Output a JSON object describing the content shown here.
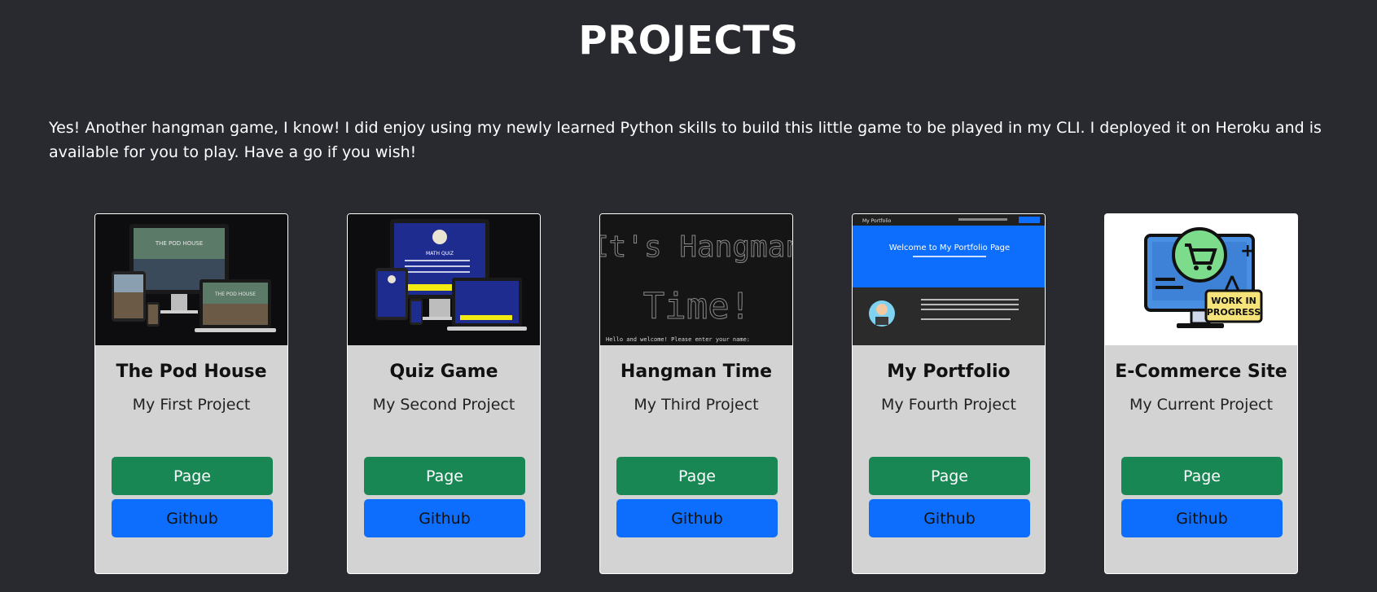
{
  "header": {
    "title": "PROJECTS"
  },
  "intro": {
    "text": "Yes! Another hangman game, I know! I did enjoy using my newly learned Python skills to build this little game to be played in my CLI. I deployed it on Heroku and is available for you to play. Have a go if you wish!"
  },
  "colors": {
    "background": "#282a30",
    "card": "#d3d3d3",
    "page_button": "#198754",
    "github_button": "#0d6efd"
  },
  "projects": [
    {
      "title": "The Pod House",
      "subtitle": "My First Project",
      "page_label": "Page",
      "github_label": "Github",
      "image": "devices-mockup-pod-house",
      "thumb_text": {
        "heading": "THE POD HOUSE"
      }
    },
    {
      "title": "Quiz Game",
      "subtitle": "My Second Project",
      "page_label": "Page",
      "github_label": "Github",
      "image": "devices-mockup-quiz",
      "thumb_text": {
        "heading": "MATH QUIZ"
      }
    },
    {
      "title": "Hangman Time",
      "subtitle": "My Third Project",
      "page_label": "Page",
      "github_label": "Github",
      "image": "terminal-screenshot",
      "thumb_text": {
        "line1": "It's Hangman",
        "line2": "Time!",
        "prompt": "Hello and welcome! Please enter your name: "
      }
    },
    {
      "title": "My Portfolio",
      "subtitle": "My Fourth Project",
      "page_label": "Page",
      "github_label": "Github",
      "image": "portfolio-screenshot",
      "thumb_text": {
        "brand": "My Portfolio",
        "heading": "Welcome to My Portfolio Page"
      }
    },
    {
      "title": "E-Commerce Site",
      "subtitle": "My Current Project",
      "page_label": "Page",
      "github_label": "Github",
      "image": "work-in-progress-illustration",
      "thumb_text": {
        "sign_line1": "WORK IN",
        "sign_line2": "PROGRESS"
      }
    }
  ]
}
